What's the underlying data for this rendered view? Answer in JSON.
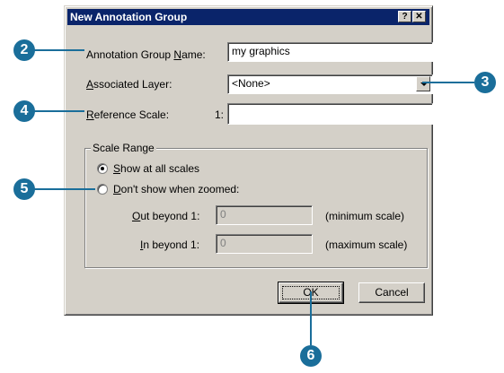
{
  "dialog": {
    "title": "New Annotation Group",
    "help_btn": "?",
    "close_btn": "✕"
  },
  "form": {
    "group_name_label_pre": "Annotation Group ",
    "group_name_label_u": "N",
    "group_name_label_post": "ame:",
    "group_name_value": "my graphics",
    "layer_label_u": "A",
    "layer_label_post": "ssociated Layer:",
    "layer_value": "<None>",
    "ref_label_u": "R",
    "ref_label_post": "eference Scale:",
    "ref_prefix": "1:",
    "ref_value": ""
  },
  "scale_range": {
    "legend": "Scale Range",
    "show_all_u": "S",
    "show_all_post": "how at all scales",
    "dont_show_u": "D",
    "dont_show_post": "on't show when zoomed:",
    "selected": "show_all",
    "out_label_u": "O",
    "out_label_post": "ut beyond  1:",
    "out_value": "0",
    "out_hint": "(minimum scale)",
    "in_label_u": "I",
    "in_label_post": "n beyond  1:",
    "in_value": "0",
    "in_hint": "(maximum scale)"
  },
  "buttons": {
    "ok": "OK",
    "cancel": "Cancel"
  },
  "callouts": [
    "2",
    "3",
    "4",
    "5",
    "6"
  ]
}
